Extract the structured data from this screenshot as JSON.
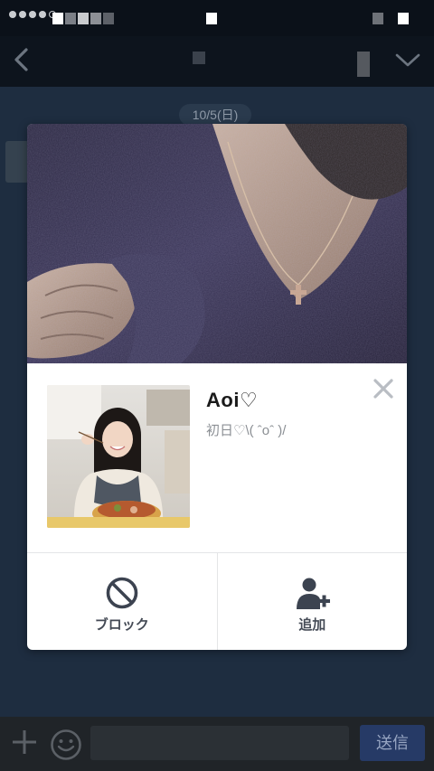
{
  "chat": {
    "date_label": "10/5(日)",
    "send_label": "送信"
  },
  "profile_popup": {
    "name": "Aoi♡",
    "status_message": "初日♡\\( ˆoˆ )/",
    "actions": [
      {
        "label": "ブロック",
        "icon": "block-icon"
      },
      {
        "label": "追加",
        "icon": "add-friend-icon"
      }
    ],
    "close_icon": "close-icon",
    "accent_color": "#3c4350"
  },
  "icons": {
    "back": "chevron-left-icon",
    "menu": "chevron-down-icon",
    "attach": "plus-icon",
    "sticker": "smile-icon"
  }
}
